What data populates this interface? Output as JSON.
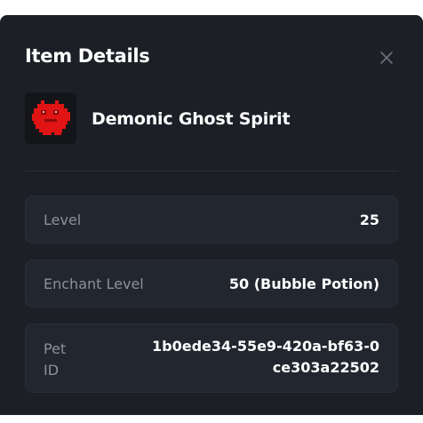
{
  "modal": {
    "title": "Item Details",
    "close_icon": "close-icon"
  },
  "item": {
    "name": "Demonic Ghost Spirit",
    "thumbnail_icon": "demonic-ghost-spirit-icon"
  },
  "details": [
    {
      "label": "Level",
      "value": "25"
    },
    {
      "label": "Enchant Level",
      "value": "50 (Bubble Potion)"
    },
    {
      "label": "Pet ID",
      "value": "1b0ede34-55e9-420a-bf63-0ce303a22502"
    }
  ],
  "colors": {
    "background": "#1c1f26",
    "card": "#22262e",
    "label": "#8b909a",
    "text": "#ffffff",
    "pet_red": "#e01414"
  }
}
